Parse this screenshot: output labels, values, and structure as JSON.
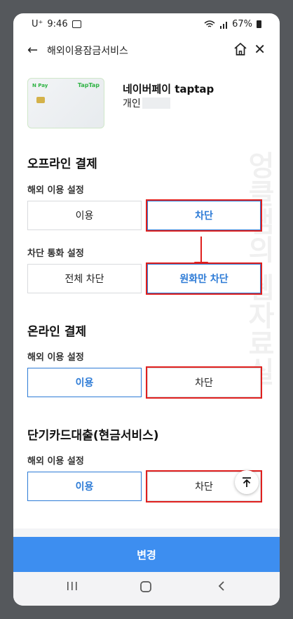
{
  "status": {
    "carrier": "U⁺",
    "time": "9:46",
    "battery": "67%"
  },
  "header": {
    "back_icon": "arrow-left-icon",
    "title": "해외이용잠금서비스",
    "home_icon": "home-icon",
    "close_icon": "close-icon"
  },
  "card": {
    "brand_left": "N Pay",
    "brand_right": "TapTap",
    "name": "네이버페이 taptap",
    "owner": "개인"
  },
  "offline": {
    "title": "오프라인 결제",
    "overseas": {
      "label": "해외 이용 설정",
      "use": "이용",
      "block": "차단",
      "selected": "block"
    },
    "currency": {
      "label": "차단 통화 설정",
      "all_block": "전체 차단",
      "krw_only": "원화만 차단",
      "selected": "krw_only"
    }
  },
  "online": {
    "title": "온라인 결제",
    "overseas": {
      "label": "해외 이용 설정",
      "use": "이용",
      "block": "차단",
      "selected": "use"
    }
  },
  "cash": {
    "title": "단기카드대출(현금서비스)",
    "overseas": {
      "label": "해외 이용 설정",
      "use": "이용",
      "block": "차단",
      "selected": "use"
    }
  },
  "watermark": "엉클샘의 웹자료실",
  "cta": {
    "label": "변경"
  },
  "colors": {
    "accent": "#2d7bd6",
    "cta": "#3d8ef0",
    "highlight": "#e0201e"
  }
}
